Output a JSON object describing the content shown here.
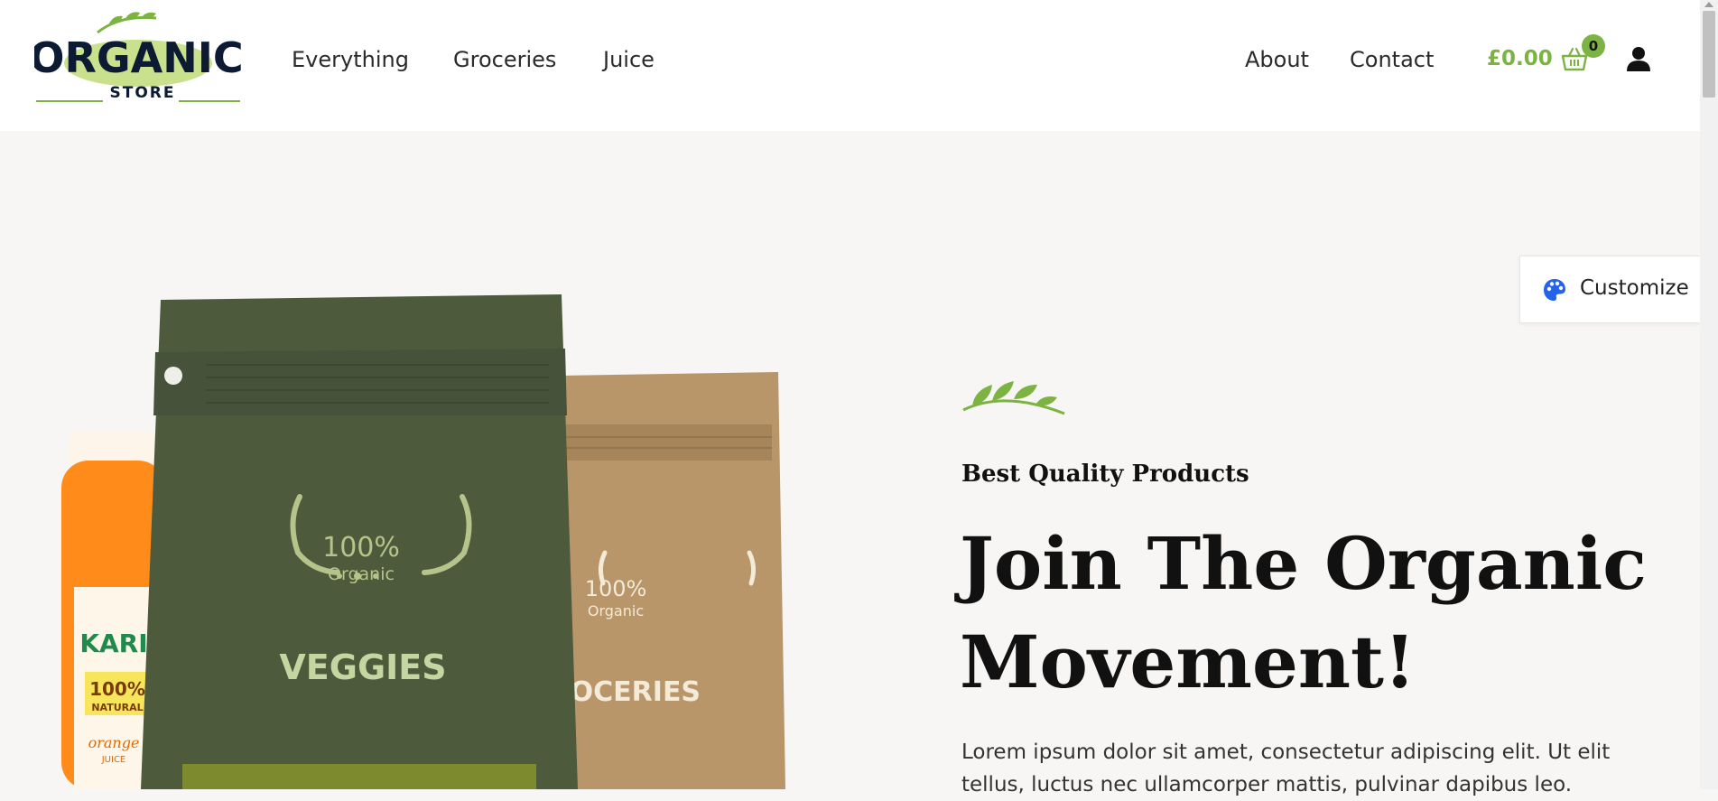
{
  "brand": {
    "logo_word": "ORGANIC",
    "logo_sub": "STORE"
  },
  "nav": {
    "primary": [
      {
        "label": "Everything"
      },
      {
        "label": "Groceries"
      },
      {
        "label": "Juice"
      }
    ],
    "secondary": [
      {
        "label": "About"
      },
      {
        "label": "Contact"
      }
    ]
  },
  "cart": {
    "total": "£0.00",
    "count": "0",
    "icon": "basket-icon"
  },
  "account": {
    "icon": "user-icon"
  },
  "customize": {
    "label": "Customize",
    "icon": "palette-icon"
  },
  "hero": {
    "subtitle": "Best Quality Products",
    "headline": "Join The Organic Movement!",
    "paragraph": "Lorem ipsum dolor sit amet, consectetur adipiscing elit. Ut elit tellus, luctus nec ullamcorper mattis, pulvinar dapibus leo.",
    "products": {
      "veggies_badge": "100%",
      "veggies_badge_sub": "Organic",
      "veggies_label": "VEGGIES",
      "groceries_badge": "100%",
      "groceries_badge_sub": "Organic",
      "groceries_label": "GROCERIES",
      "jar_brand": "KARI",
      "jar_badge": "100%",
      "jar_natural": "NATURAL",
      "jar_flavor": "orange",
      "jar_type": "JUICE"
    }
  },
  "colors": {
    "accent": "#7cb342",
    "veggie_bag": "#4d5a3c",
    "grocery_bag": "#b8966a",
    "jar": "#ff8c1a",
    "background": "#f7f6f4"
  }
}
